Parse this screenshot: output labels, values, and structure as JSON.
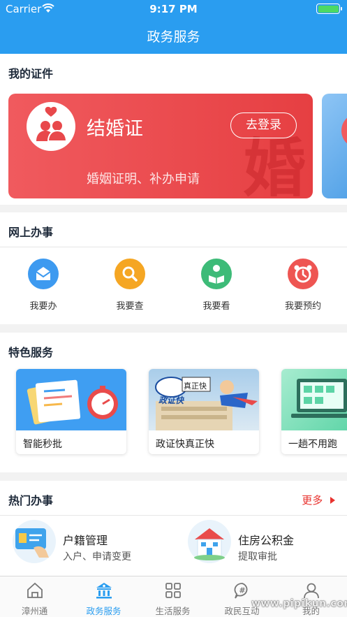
{
  "status_bar": {
    "carrier": "Carrier",
    "time": "9:17 PM"
  },
  "nav": {
    "title": "政务服务"
  },
  "my_certs": {
    "title": "我的证件",
    "card": {
      "title": "结婚证",
      "login_label": "去登录",
      "subtitle": "婚姻证明、补办申请",
      "watermark": "婚"
    }
  },
  "online": {
    "title": "网上办事",
    "actions": [
      {
        "label": "我要办",
        "icon": "mail-icon",
        "color": "#3d9af0"
      },
      {
        "label": "我要查",
        "icon": "search-icon",
        "color": "#f5a623"
      },
      {
        "label": "我要看",
        "icon": "reader-icon",
        "color": "#3dbb78"
      },
      {
        "label": "我要预约",
        "icon": "alarm-clock-icon",
        "color": "#ee5552"
      }
    ]
  },
  "featured": {
    "title": "特色服务",
    "cards": [
      {
        "label": "智能秒批"
      },
      {
        "label": "政证快真正快",
        "sign_text": "政证快",
        "banner_text": "真正快"
      },
      {
        "label": "一趟不用跑"
      }
    ]
  },
  "hot": {
    "title": "热门办事",
    "more_label": "更多",
    "items": [
      {
        "title": "户籍管理",
        "subtitle": "入户、申请变更"
      },
      {
        "title": "住房公积金",
        "subtitle": "提取审批"
      }
    ]
  },
  "tabbar": {
    "tabs": [
      {
        "label": "漳州通"
      },
      {
        "label": "政务服务"
      },
      {
        "label": "生活服务"
      },
      {
        "label": "政民互动"
      },
      {
        "label": "我的"
      }
    ],
    "active_color": "#2a9df0"
  },
  "watermark_text": "www.pipikun.com"
}
